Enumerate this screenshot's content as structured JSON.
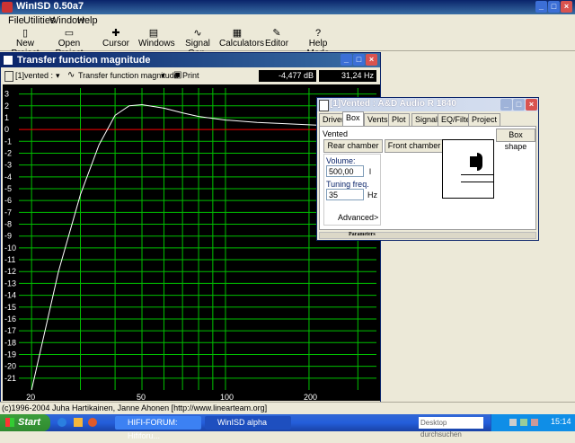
{
  "app": {
    "title": "WinISD 0.50a7"
  },
  "menu": [
    "File",
    "Utilities",
    "Window",
    "Help"
  ],
  "toolbar": [
    {
      "label": "New Project",
      "icon": "new-doc-icon"
    },
    {
      "label": "Open Project",
      "icon": "folder-icon"
    },
    {
      "label": "Cursor",
      "icon": "cursor-icon"
    },
    {
      "label": "Windows",
      "icon": "windows-icon"
    },
    {
      "label": "Signal Gen.",
      "icon": "signal-icon"
    },
    {
      "label": "Calculators",
      "icon": "calculator-icon"
    },
    {
      "label": "Editor",
      "icon": "editor-icon"
    },
    {
      "label": "Help Mode",
      "icon": "help-icon"
    }
  ],
  "tf_window": {
    "title": "Transfer function magnitude",
    "project_select": "[1]vented :",
    "graph_select": "Transfer function magnitude",
    "print": "Print",
    "readout_db": "-4,477 dB",
    "readout_hz": "31,24 Hz"
  },
  "dialog": {
    "title": "[1]Vented : A&D Audio R 1840",
    "tabs": [
      "Driver",
      "Box",
      "Vents",
      "Plot",
      "Signal",
      "EQ/Filter",
      "Project"
    ],
    "type": "Vented",
    "box_shape": "Box shape",
    "rear_chamber": "Rear chamber",
    "front_chamber": "Front chamber",
    "volume_label": "Volume:",
    "volume_value": "500,00",
    "volume_unit": "l",
    "tuning_label": "Tuning freq.",
    "tuning_value": "35",
    "tuning_unit": "Hz",
    "advanced": "Advanced>",
    "params": "Parameters"
  },
  "status": "(c)1996-2004 Juha Hartikainen, Janne Ahonen [http://www.linearteam.org]",
  "taskbar": {
    "start": "Start",
    "tasks": [
      "HIFI-FORUM: Hififoru...",
      "WinISD alpha"
    ],
    "search": "Desktop durchsuchen",
    "clock": "15:14"
  },
  "chart_data": {
    "type": "line",
    "x": [
      20,
      25,
      30,
      35,
      40,
      45,
      50,
      60,
      70,
      80,
      100,
      130,
      160,
      200,
      250,
      300
    ],
    "series": [
      {
        "values": [
          -22,
          -12,
          -5.5,
          -1.3,
          1.2,
          2.0,
          2.1,
          1.8,
          1.4,
          1.1,
          0.8,
          0.6,
          0.5,
          0.4,
          0.3,
          0.25
        ]
      }
    ],
    "y_ticks": [
      3,
      2,
      1,
      0,
      -1,
      -2,
      -3,
      -4,
      -5,
      -6,
      -7,
      -8,
      -9,
      -10,
      -11,
      -12,
      -13,
      -14,
      -15,
      -16,
      -17,
      -18,
      -19,
      -20,
      -21
    ],
    "x_ticks": [
      "20",
      "50",
      "100",
      "200"
    ],
    "xlim": [
      18,
      350
    ],
    "ylim": [
      -22,
      3.5
    ],
    "scale_x": "log",
    "colors": {
      "curve": "#ffffff",
      "grid": "#00c000",
      "zero": "#ff0000",
      "bg": "#000000"
    }
  }
}
